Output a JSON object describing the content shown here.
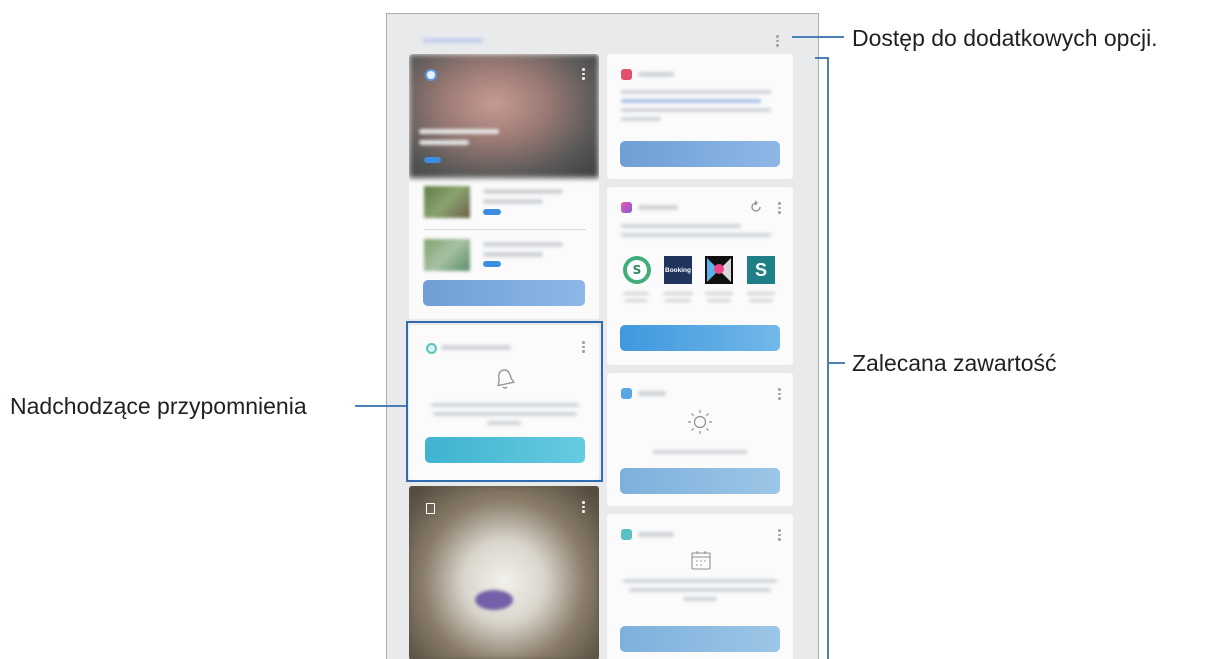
{
  "callouts": {
    "more_options": "Dostęp do dodatkowych opcji.",
    "recommended": "Zalecana zawartość",
    "reminders": "Nadchodzące przypomnienia"
  },
  "app_tiles": [
    "S",
    "Booking",
    "",
    "S"
  ],
  "colors": {
    "callout_line": "#4a7fb8",
    "highlight_box": "#2f6db0",
    "screen_bg": "#e8eaec"
  },
  "icons": [
    "more-options-icon",
    "bell-icon",
    "refresh-icon",
    "sun-icon",
    "calendar-icon"
  ]
}
